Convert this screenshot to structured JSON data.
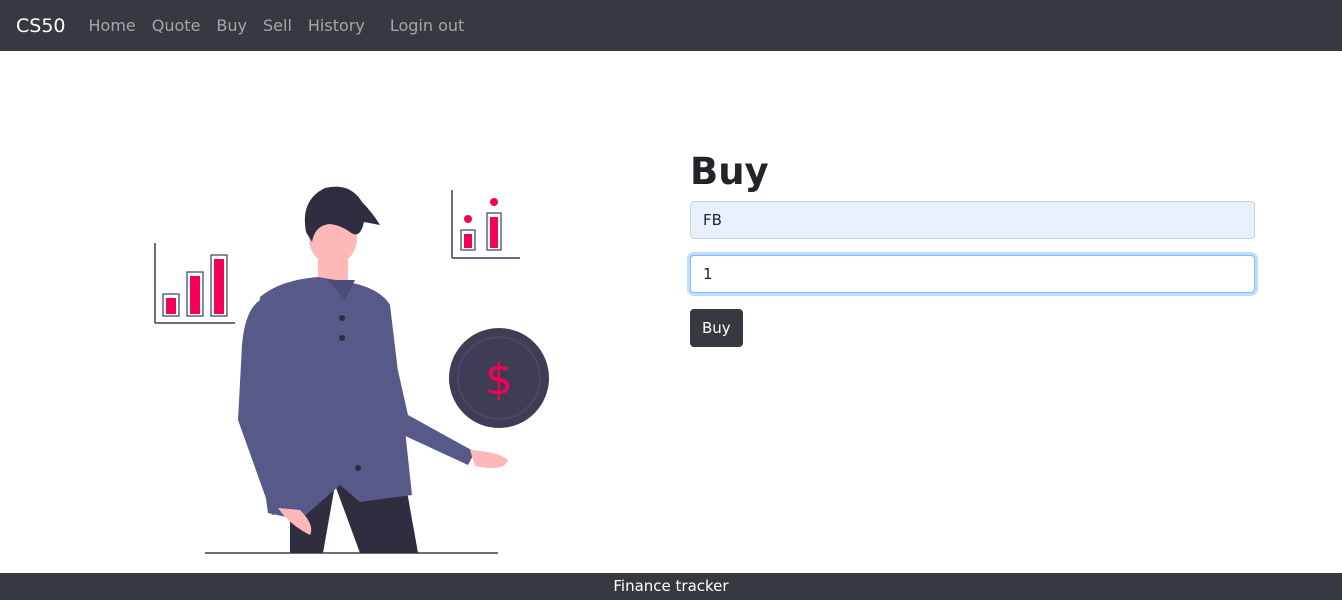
{
  "navbar": {
    "brand": "CS50",
    "links": [
      "Home",
      "Quote",
      "Buy",
      "Sell",
      "History"
    ],
    "logout": "Login out"
  },
  "form": {
    "title": "Buy",
    "symbol_value": "FB",
    "shares_value": "1",
    "submit_label": "Buy"
  },
  "footer": {
    "text": "Finance tracker"
  },
  "colors": {
    "navbar_bg": "#343a40",
    "accent": "#f50057",
    "shirt": "#575a89",
    "coin": "#3f3d56"
  },
  "illustration": {
    "coin_symbol": "$"
  }
}
